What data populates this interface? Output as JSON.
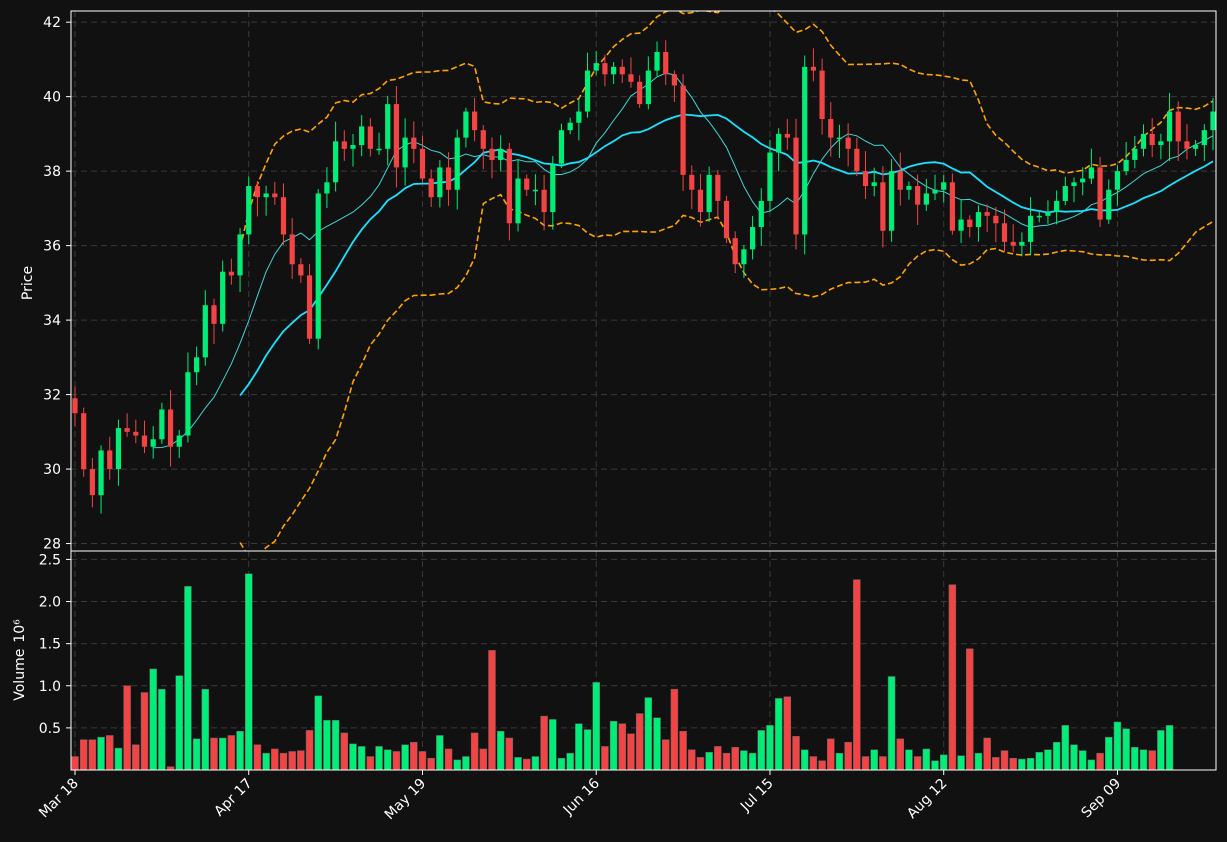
{
  "chart_data": {
    "type": "candlestick",
    "price_panel": {
      "ylabel": "Price",
      "ylim": [
        27.8,
        42.3
      ],
      "yticks": [
        28,
        30,
        32,
        34,
        36,
        38,
        40,
        42
      ],
      "grid": true
    },
    "volume_panel": {
      "ylabel": "Volume",
      "ylabel_exponent": "10⁶",
      "ylim": [
        0,
        2.6
      ],
      "yticks": [
        0.5,
        1.0,
        1.5,
        2.0,
        2.5
      ],
      "ytick_labels": [
        "0.5",
        "1.0",
        "1.5",
        "2.0",
        "2.5"
      ],
      "grid": true
    },
    "x_tick_labels": [
      {
        "label": "Mar 18",
        "index": 0
      },
      {
        "label": "Apr 17",
        "index": 20
      },
      {
        "label": "May 19",
        "index": 40
      },
      {
        "label": "Jun 16",
        "index": 60
      },
      {
        "label": "Jul 15",
        "index": 80
      },
      {
        "label": "Aug 12",
        "index": 100
      },
      {
        "label": "Sep 09",
        "index": 120
      }
    ],
    "closes": [
      31.5,
      30.0,
      29.3,
      30.5,
      30.0,
      31.1,
      31.0,
      30.9,
      30.6,
      30.8,
      31.6,
      30.6,
      30.9,
      32.6,
      33.0,
      34.4,
      33.9,
      35.3,
      35.2,
      36.3,
      37.6,
      37.3,
      37.4,
      37.3,
      36.3,
      35.5,
      35.2,
      33.5,
      37.4,
      37.7,
      38.8,
      38.6,
      38.7,
      39.2,
      38.6,
      38.6,
      39.8,
      38.1,
      38.9,
      38.6,
      37.8,
      37.3,
      38.1,
      37.5,
      38.9,
      39.6,
      39.1,
      38.6,
      38.3,
      38.6,
      36.6,
      37.8,
      37.5,
      37.5,
      36.9,
      38.2,
      39.1,
      39.3,
      39.6,
      40.7,
      40.9,
      40.6,
      40.8,
      40.6,
      40.4,
      39.8,
      40.7,
      41.2,
      40.6,
      40.3,
      37.9,
      37.5,
      36.9,
      37.9,
      37.2,
      36.2,
      35.5,
      35.9,
      36.5,
      37.2,
      38.5,
      39.0,
      38.9,
      36.3,
      40.8,
      40.7,
      39.4,
      38.9,
      38.9,
      38.6,
      38.0,
      37.6,
      37.7,
      36.4,
      38.0,
      37.5,
      37.6,
      37.1,
      37.4,
      37.5,
      37.7,
      36.4,
      36.7,
      36.5,
      36.9,
      36.8,
      36.6,
      36.1,
      36.0,
      36.1,
      36.8,
      36.8,
      36.9,
      37.2,
      37.6,
      37.7,
      37.8,
      38.1,
      36.7,
      37.5,
      38.0,
      38.3,
      38.6,
      39.0,
      38.7,
      38.8,
      39.6,
      38.8,
      38.6,
      38.7,
      39.1,
      39.6
    ],
    "volumes": [
      0.16,
      0.36,
      0.36,
      0.39,
      0.41,
      0.26,
      1.0,
      0.3,
      0.92,
      1.2,
      0.96,
      0.04,
      1.12,
      2.18,
      0.37,
      0.96,
      0.38,
      0.38,
      0.41,
      0.46,
      2.33,
      0.3,
      0.2,
      0.25,
      0.2,
      0.22,
      0.23,
      0.47,
      0.88,
      0.59,
      0.59,
      0.44,
      0.31,
      0.28,
      0.16,
      0.28,
      0.24,
      0.22,
      0.3,
      0.33,
      0.22,
      0.14,
      0.41,
      0.25,
      0.12,
      0.16,
      0.44,
      0.25,
      1.42,
      0.46,
      0.38,
      0.15,
      0.13,
      0.16,
      0.64,
      0.6,
      0.14,
      0.2,
      0.55,
      0.48,
      1.04,
      0.28,
      0.58,
      0.55,
      0.43,
      0.67,
      0.86,
      0.62,
      0.36,
      0.96,
      0.46,
      0.24,
      0.15,
      0.21,
      0.28,
      0.2,
      0.27,
      0.23,
      0.2,
      0.47,
      0.53,
      0.85,
      0.87,
      0.4,
      0.24,
      0.16,
      0.11,
      0.37,
      0.2,
      0.33,
      2.26,
      0.16,
      0.24,
      0.16,
      1.11,
      0.37,
      0.24,
      0.16,
      0.25,
      0.11,
      0.18,
      2.2,
      0.17,
      1.44,
      0.2,
      0.38,
      0.15,
      0.23,
      0.14,
      0.13,
      0.14,
      0.21,
      0.24,
      0.33,
      0.53,
      0.3,
      0.23,
      0.12,
      0.2,
      0.39,
      0.57,
      0.49,
      0.27,
      0.24,
      0.23,
      0.47,
      0.53
    ],
    "series": [
      {
        "name": "",
        "kind": "moving-average-short",
        "color": "#3fd6d6"
      },
      {
        "name": "",
        "kind": "moving-average-long",
        "color": "#19e3ff"
      },
      {
        "name": "",
        "kind": "bollinger-bands",
        "color": "#ffa500"
      }
    ],
    "colors": {
      "up": "#00ee77",
      "down": "#f24444",
      "background": "#111111",
      "text": "#ffffff",
      "grid": "#3a3a3a"
    }
  }
}
